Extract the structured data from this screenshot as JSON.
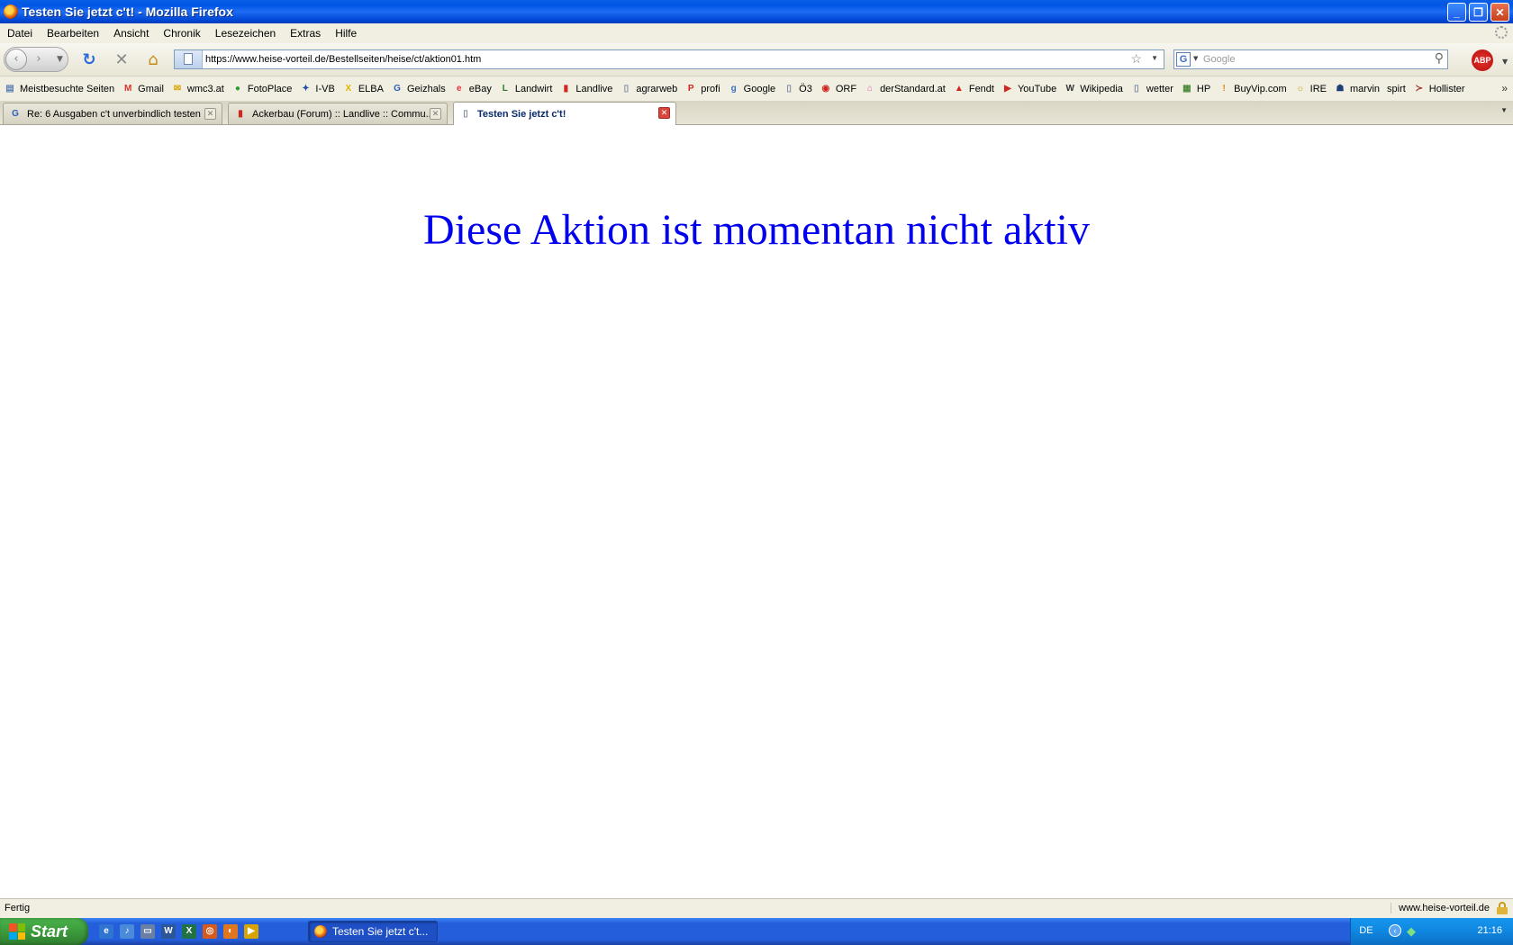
{
  "window": {
    "title": "Testen Sie jetzt c't! - Mozilla Firefox",
    "buttons": {
      "minimize": "_",
      "maximize": "❐",
      "close": "✕"
    }
  },
  "menu": [
    "Datei",
    "Bearbeiten",
    "Ansicht",
    "Chronik",
    "Lesezeichen",
    "Extras",
    "Hilfe"
  ],
  "nav": {
    "url": "https://www.heise-vorteil.de/Bestellseiten/heise/ct/aktion01.htm",
    "search_placeholder": "Google",
    "search_engine": "G",
    "adblock_label": "ABP"
  },
  "bookmarks": [
    {
      "label": "Meistbesuchte Seiten",
      "icon": "folder-icon",
      "glyph": "▤",
      "color": "#5b7fb5"
    },
    {
      "label": "Gmail",
      "icon": "gmail-icon",
      "glyph": "M",
      "color": "#d93025"
    },
    {
      "label": "wmc3.at",
      "icon": "wmc3-icon",
      "glyph": "✉",
      "color": "#d9a400"
    },
    {
      "label": "FotoPlace",
      "icon": "fotoplace-icon",
      "glyph": "●",
      "color": "#2e9b2e"
    },
    {
      "label": "I-VB",
      "icon": "ivb-icon",
      "glyph": "✦",
      "color": "#1f4fa8"
    },
    {
      "label": "ELBA",
      "icon": "elba-icon",
      "glyph": "X",
      "color": "#e2b400"
    },
    {
      "label": "Geizhals",
      "icon": "geizhals-icon",
      "glyph": "G",
      "color": "#2c5fb8"
    },
    {
      "label": "eBay",
      "icon": "ebay-icon",
      "glyph": "e",
      "color": "#e53238"
    },
    {
      "label": "Landwirt",
      "icon": "landwirt-icon",
      "glyph": "L",
      "color": "#2f7a2f"
    },
    {
      "label": "Landlive",
      "icon": "landlive-icon",
      "glyph": "▮",
      "color": "#d0261f"
    },
    {
      "label": "agrarweb",
      "icon": "page-icon",
      "glyph": "▯",
      "color": "#7d8ba3"
    },
    {
      "label": "profi",
      "icon": "profi-icon",
      "glyph": "P",
      "color": "#d0261f"
    },
    {
      "label": "Google",
      "icon": "google-icon",
      "glyph": "g",
      "color": "#3b6fc6"
    },
    {
      "label": "Ö3",
      "icon": "page-icon",
      "glyph": "▯",
      "color": "#7d8ba3"
    },
    {
      "label": "ORF",
      "icon": "orf-icon",
      "glyph": "◉",
      "color": "#d0261f"
    },
    {
      "label": "derStandard.at",
      "icon": "derstandard-icon",
      "glyph": "⌂",
      "color": "#e05aa8"
    },
    {
      "label": "Fendt",
      "icon": "fendt-icon",
      "glyph": "▲",
      "color": "#d0261f"
    },
    {
      "label": "YouTube",
      "icon": "youtube-icon",
      "glyph": "▶",
      "color": "#d0261f"
    },
    {
      "label": "Wikipedia",
      "icon": "wikipedia-icon",
      "glyph": "W",
      "color": "#333333"
    },
    {
      "label": "wetter",
      "icon": "page-icon",
      "glyph": "▯",
      "color": "#7d8ba3"
    },
    {
      "label": "HP",
      "icon": "hp-icon",
      "glyph": "▦",
      "color": "#4a8a3a"
    },
    {
      "label": "BuyVip.com",
      "icon": "buyvip-icon",
      "glyph": "!",
      "color": "#e0861a"
    },
    {
      "label": "IRE",
      "icon": "ire-icon",
      "glyph": "☼",
      "color": "#c8a01a"
    },
    {
      "label": "marvin",
      "icon": "marvin-icon",
      "glyph": "☗",
      "color": "#1f3f7a"
    },
    {
      "label": "spirt",
      "icon": "",
      "glyph": "",
      "color": "#000000"
    },
    {
      "label": "Hollister",
      "icon": "hollister-icon",
      "glyph": "≻",
      "color": "#a03020"
    }
  ],
  "tabs": [
    {
      "label": "Re: 6 Ausgaben c't unverbindlich testen",
      "icon": "geizhals-icon",
      "glyph": "G",
      "color": "#2c5fb8",
      "active": false
    },
    {
      "label": "Ackerbau (Forum) :: Landlive :: Commu...",
      "icon": "landlive-icon",
      "glyph": "▮",
      "color": "#d0261f",
      "active": false
    },
    {
      "label": "Testen Sie jetzt c't!",
      "icon": "page-icon",
      "glyph": "▯",
      "color": "#7d8ba3",
      "active": true
    }
  ],
  "content": {
    "message": "Diese Aktion ist momentan nicht aktiv"
  },
  "status": {
    "text": "Fertig",
    "domain": "www.heise-vorteil.de"
  },
  "taskbar": {
    "start_label": "Start",
    "window_button": "Testen Sie jetzt c't...",
    "language": "DE",
    "clock": "21:16"
  }
}
